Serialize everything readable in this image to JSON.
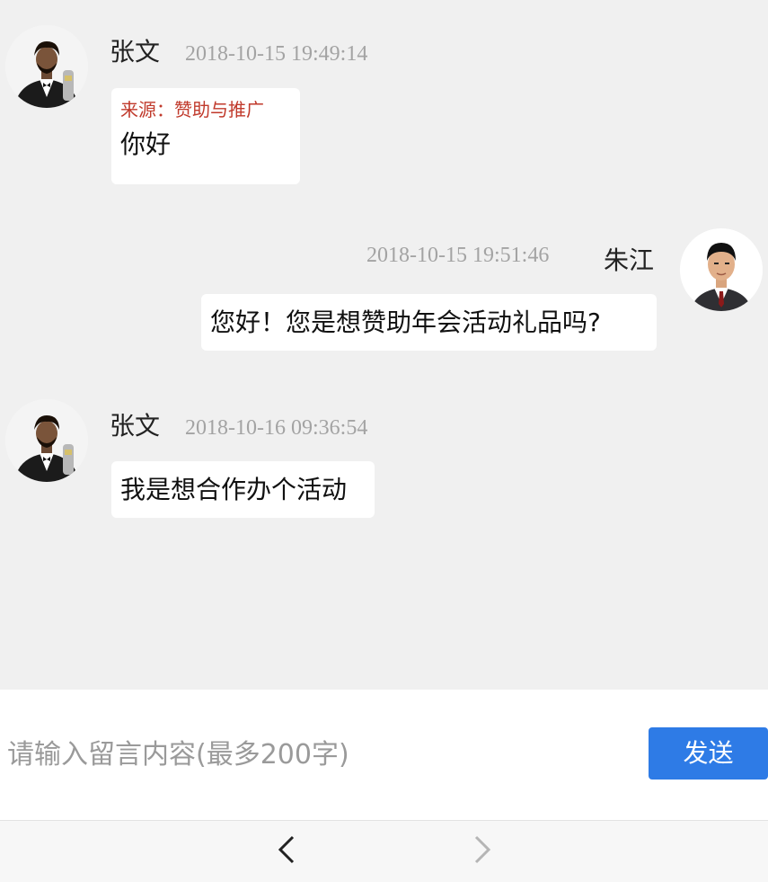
{
  "messages": [
    {
      "sender": "张文",
      "time": "2018-10-15 19:49:14",
      "source": "来源：赞助与推广",
      "text": "你好"
    },
    {
      "sender": "朱江",
      "time": "2018-10-15 19:51:46",
      "text": "您好！您是想赞助年会活动礼品吗?"
    },
    {
      "sender": "张文",
      "time": "2018-10-16 09:36:54",
      "text": "我是想合作办个活动"
    }
  ],
  "composer": {
    "placeholder": "请输入留言内容(最多200字)",
    "send_label": "发送"
  },
  "nav": {
    "back_icon": "chevron-left-icon",
    "forward_icon": "chevron-right-icon"
  },
  "colors": {
    "background": "#f0f0f0",
    "bubble": "#ffffff",
    "source_text": "#c0392b",
    "timestamp": "#a3a3a3",
    "send_button": "#2e7be6"
  }
}
